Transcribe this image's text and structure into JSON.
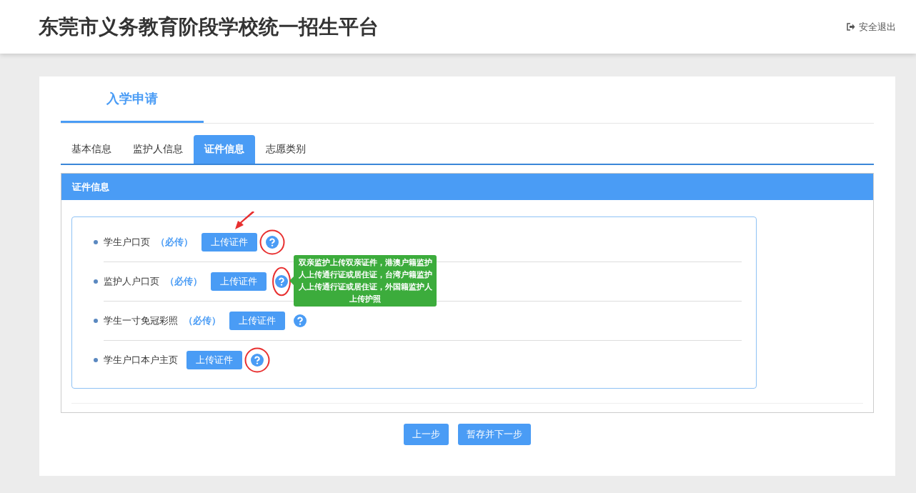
{
  "header": {
    "title": "东莞市义务教育阶段学校统一招生平台",
    "logout": "安全退出"
  },
  "page_title": "入学申请",
  "tabs": [
    {
      "label": "基本信息",
      "selected": false
    },
    {
      "label": "监护人信息",
      "selected": false
    },
    {
      "label": "证件信息",
      "selected": true
    },
    {
      "label": "志愿类别",
      "selected": false
    }
  ],
  "panel": {
    "title": "证件信息",
    "items": [
      {
        "label": "学生户口页",
        "required": "（必传）",
        "button": "上传证件",
        "circled": true,
        "arrow": true
      },
      {
        "label": "监护人户口页",
        "required": "（必传）",
        "button": "上传证件",
        "circled": true,
        "arrow": false,
        "tooltip": "双亲监护上传双亲证件，港澳户籍监护人上传通行证或居住证，台湾户籍监护人上传通行证或居住证，外国籍监护人上传护照"
      },
      {
        "label": "学生一寸免冠彩照",
        "required": "（必传）",
        "button": "上传证件",
        "circled": false,
        "arrow": false
      },
      {
        "label": "学生户口本户主页",
        "button": "上传证件",
        "circled": true,
        "arrow": false
      }
    ]
  },
  "buttons": [
    {
      "label": "上一步"
    },
    {
      "label": "暂存并下一步"
    }
  ]
}
